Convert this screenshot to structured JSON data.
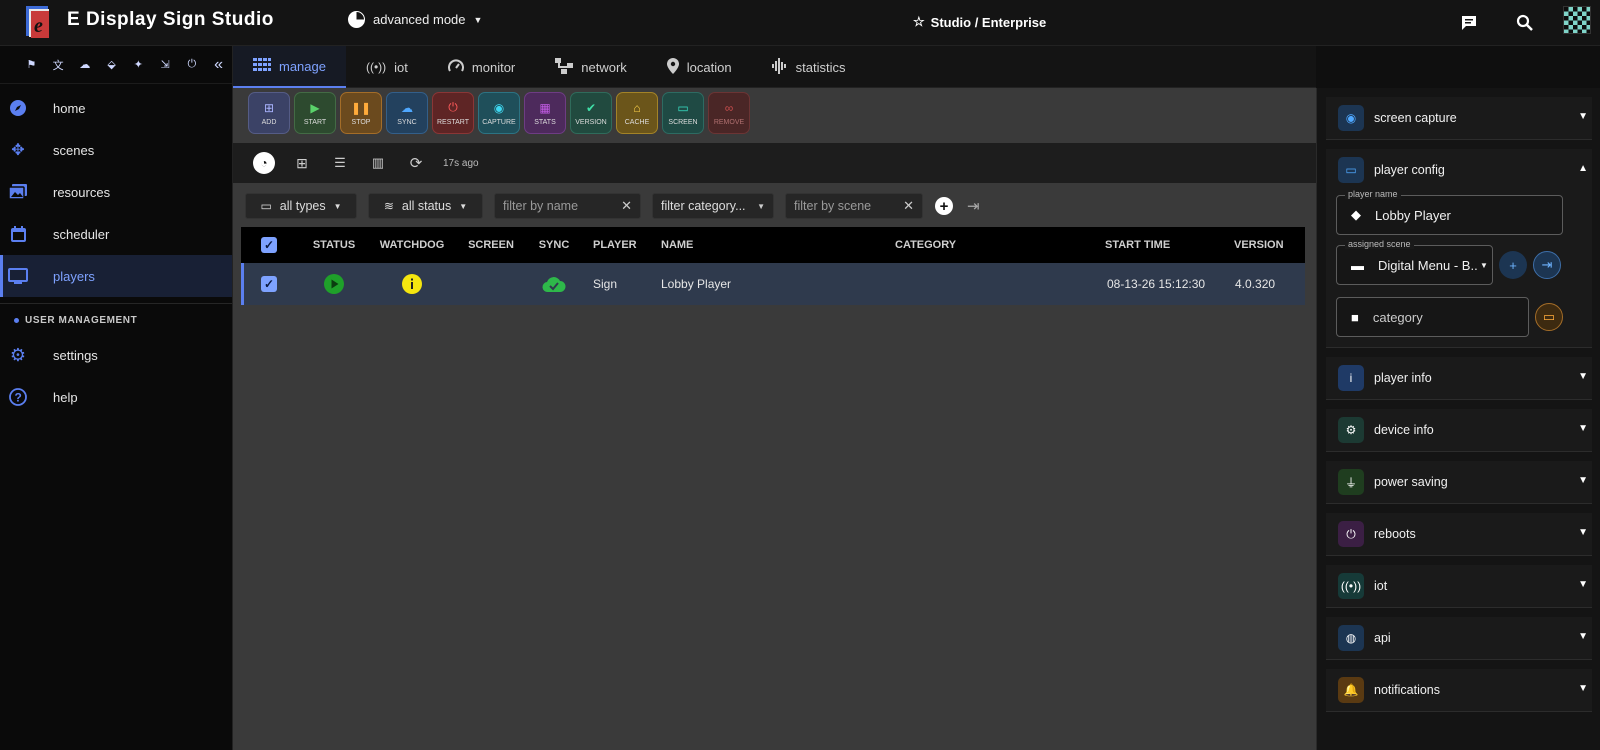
{
  "header": {
    "app_title": "E Display Sign Studio",
    "mode_label": "advanced mode",
    "studio_label": "Studio / Enterprise"
  },
  "sidebar": {
    "items": [
      {
        "label": "home",
        "icon": "compass-icon"
      },
      {
        "label": "scenes",
        "icon": "move-icon"
      },
      {
        "label": "resources",
        "icon": "photos-icon"
      },
      {
        "label": "scheduler",
        "icon": "calendar-icon"
      },
      {
        "label": "players",
        "icon": "monitor-icon"
      }
    ],
    "section_label": "USER MANAGEMENT",
    "bottom_items": [
      {
        "label": "settings",
        "icon": "gear-icon"
      },
      {
        "label": "help",
        "icon": "help-icon"
      }
    ]
  },
  "tabs": [
    {
      "label": "manage",
      "icon": "grid-icon"
    },
    {
      "label": "iot",
      "icon": "broadcast-icon"
    },
    {
      "label": "monitor",
      "icon": "gauge-icon"
    },
    {
      "label": "network",
      "icon": "network-icon"
    },
    {
      "label": "location",
      "icon": "pin-icon"
    },
    {
      "label": "statistics",
      "icon": "waveform-icon"
    }
  ],
  "actions": [
    {
      "label": "ADD",
      "color": "#3b4266"
    },
    {
      "label": "START",
      "color": "#2d4a2f"
    },
    {
      "label": "STOP",
      "color": "#6b4a1e"
    },
    {
      "label": "SYNC",
      "color": "#23415e"
    },
    {
      "label": "RESTART",
      "color": "#5e2525"
    },
    {
      "label": "CAPTURE",
      "color": "#1f4f5a"
    },
    {
      "label": "STATS",
      "color": "#4d2a5c"
    },
    {
      "label": "VERSION",
      "color": "#214a3f"
    },
    {
      "label": "CACHE",
      "color": "#6b551a"
    },
    {
      "label": "SCREEN",
      "color": "#1f4a44"
    },
    {
      "label": "REMOVE",
      "color": "#4a2626"
    }
  ],
  "view_bar": {
    "updated": "17s ago"
  },
  "filters": {
    "types": "all types",
    "status": "all status",
    "name_placeholder": "filter by name",
    "category_placeholder": "filter category...",
    "scene_placeholder": "filter by scene"
  },
  "table": {
    "headers": [
      "STATUS",
      "WATCHDOG",
      "SCREEN",
      "SYNC",
      "PLAYER",
      "NAME",
      "CATEGORY",
      "START TIME",
      "VERSION"
    ],
    "rows": [
      {
        "player": "Sign",
        "name": "Lobby Player",
        "category": "",
        "start_time": "08-13-26 15:12:30",
        "version": "4.0.320"
      }
    ]
  },
  "right_panel": {
    "screen_capture": "screen capture",
    "player_config": "player config",
    "player_name_label": "player name",
    "player_name": "Lobby Player",
    "assigned_scene_label": "assigned scene",
    "assigned_scene": "Digital Menu - B...",
    "category_placeholder": "category",
    "sections": [
      {
        "label": "player info",
        "color": "#1f3a66",
        "icon": "info-icon",
        "glyph": "i"
      },
      {
        "label": "device info",
        "color": "#1c3a33",
        "icon": "chip-icon",
        "glyph": "⚙"
      },
      {
        "label": "power saving",
        "color": "#1f3d1f",
        "icon": "plug-icon",
        "glyph": "⏚"
      },
      {
        "label": "reboots",
        "color": "#3b1f44",
        "icon": "power-icon",
        "glyph": "⏻"
      },
      {
        "label": "iot",
        "color": "#163a38",
        "icon": "broadcast-icon",
        "glyph": "((•))"
      },
      {
        "label": "api",
        "color": "#1c3552",
        "icon": "globe-icon",
        "glyph": "◍"
      },
      {
        "label": "notifications",
        "color": "#5a3a12",
        "icon": "bell-icon",
        "glyph": "🔔"
      }
    ]
  }
}
